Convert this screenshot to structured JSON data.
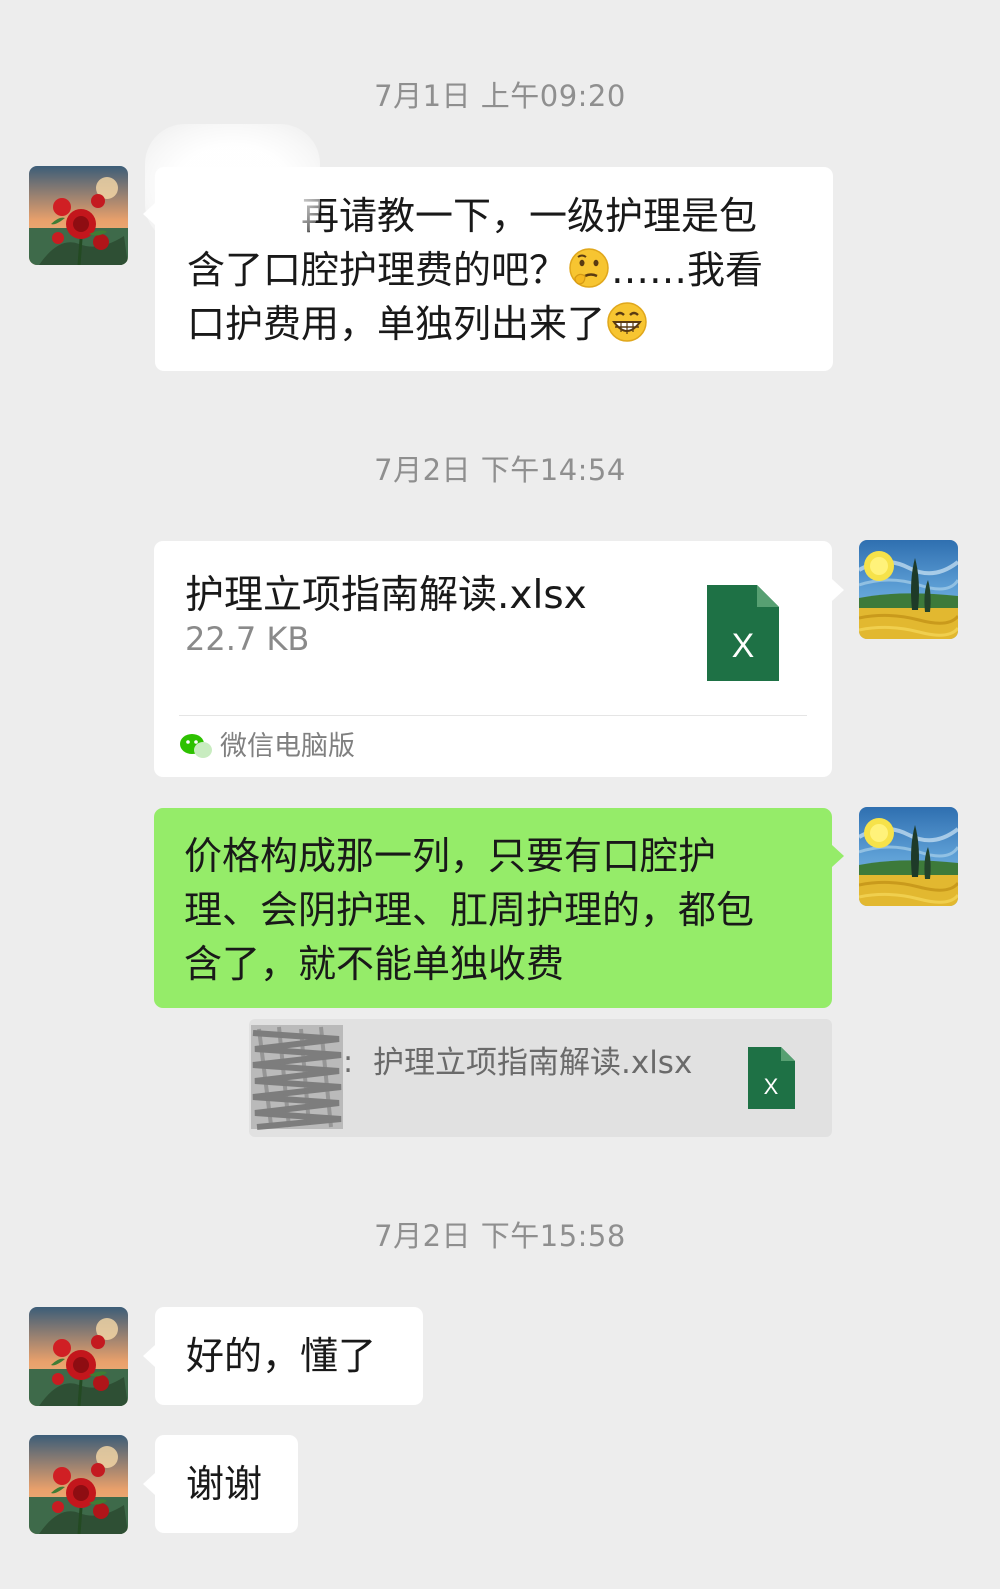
{
  "chat": {
    "timestamps": [
      "7月1日 上午09:20",
      "7月2日 下午14:54",
      "7月2日 下午15:58"
    ],
    "msg1": {
      "sender": "other",
      "text_line1": "再请教一下，一级护理是包",
      "text_line2a": "含了口腔护理费的吧？",
      "text_line2b": "……我看",
      "text_line3": "口护费用，单独列出来了",
      "emoji1": "thinking-face",
      "emoji2": "grinning-face"
    },
    "msg2": {
      "sender": "me",
      "type": "file",
      "file_name": "护理立项指南解读.xlsx",
      "file_size": "22.7 KB",
      "file_icon_letter": "X",
      "source": "微信电脑版"
    },
    "msg3": {
      "sender": "me",
      "text_lines": [
        "价格构成那一列，只要有口腔护",
        "理、会阴护理、肛周护理的，都包",
        "含了，就不能单独收费"
      ],
      "quote_colon": ":",
      "quote_file": "护理立项指南解读.xlsx",
      "quote_icon_letter": "X"
    },
    "msg4": {
      "sender": "other",
      "text": "好的，懂了"
    },
    "msg5": {
      "sender": "other",
      "text": "谢谢"
    }
  },
  "colors": {
    "background": "#ededed",
    "bubble_white": "#ffffff",
    "bubble_green": "#95ec69",
    "excel_green": "#1e7145",
    "timestamp": "#8f8f8f"
  }
}
